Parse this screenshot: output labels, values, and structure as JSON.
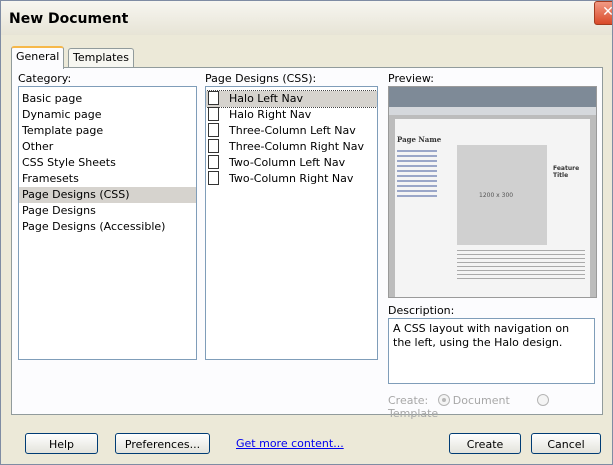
{
  "window": {
    "title": "New Document",
    "close_glyph": "✕"
  },
  "tabs": [
    {
      "label": "General"
    },
    {
      "label": "Templates"
    }
  ],
  "category": {
    "label": "Category:",
    "items": [
      "Basic page",
      "Dynamic page",
      "Template page",
      "Other",
      "CSS Style Sheets",
      "Framesets",
      "Page Designs (CSS)",
      "Page Designs",
      "Page Designs (Accessible)"
    ]
  },
  "designs": {
    "label": "Page Designs (CSS):",
    "items": [
      "Halo Left Nav",
      "Halo Right Nav",
      "Three-Column Left Nav",
      "Three-Column Right Nav",
      "Two-Column Left Nav",
      "Two-Column Right Nav"
    ]
  },
  "preview": {
    "label": "Preview:",
    "page_name": "Page Name",
    "image_size": "1200 x 300",
    "feature_title": "Feature Title"
  },
  "description": {
    "label": "Description:",
    "text": "A CSS layout with navigation on the left, using the Halo design."
  },
  "create": {
    "label": "Create:",
    "document_option": "Document",
    "template_option": "Template"
  },
  "buttons": {
    "help": "Help",
    "preferences": "Preferences...",
    "get_more": "Get more content...",
    "create": "Create",
    "cancel": "Cancel"
  }
}
